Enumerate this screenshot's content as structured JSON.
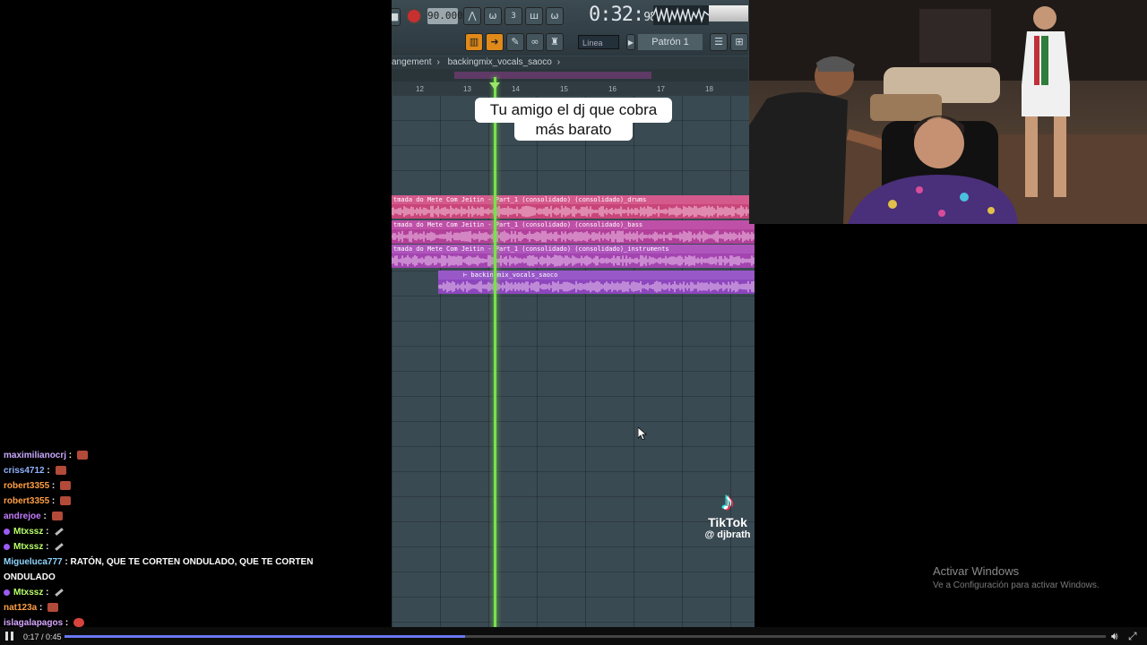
{
  "toolbar": {
    "tempo": "90.000",
    "timer_main": "0:32",
    "timer_frac": "98",
    "timer_unit": "M:S:CS",
    "snap_mode": "Línea",
    "pattern": "Patrón 1"
  },
  "breadcrumb": [
    "angement",
    "backingmix_vocals_saoco"
  ],
  "ruler": [
    "12",
    "13",
    "14",
    "15",
    "16",
    "17",
    "18"
  ],
  "tracks": [
    "tmada do Mete Com Jeitin - Part_1 (consolidado) (consolidado)_drums",
    "tmada do Mete Com Jeitin - Part_1 (consolidado) (consolidado)_bass",
    "tmada do Mete Com Jeitin - Part_1 (consolidado) (consolidado)_instruments",
    "⊢ backingmix_vocals_saoco"
  ],
  "caption": {
    "line1": "Tu amigo el dj que cobra",
    "line2": "más barato"
  },
  "tiktok": {
    "brand": "TikTok",
    "user": "@ djbrath"
  },
  "chat": [
    {
      "user": "maximilianocrj",
      "color": "#c9a9ff",
      "text": "",
      "emote": "red",
      "badge": false
    },
    {
      "user": "criss4712",
      "color": "#8fb4ff",
      "text": "",
      "emote": "red",
      "badge": false
    },
    {
      "user": "robert3355",
      "color": "#ff9f43",
      "text": "",
      "emote": "red",
      "badge": false
    },
    {
      "user": "robert3355",
      "color": "#ff9f43",
      "text": "",
      "emote": "red",
      "badge": false
    },
    {
      "user": "andrejoe",
      "color": "#c57cff",
      "text": "",
      "emote": "red",
      "badge": false
    },
    {
      "user": "Mtxssz",
      "color": "#b8ff6a",
      "text": "",
      "emote": "knife",
      "badge": true
    },
    {
      "user": "Mtxssz",
      "color": "#b8ff6a",
      "text": "",
      "emote": "knife",
      "badge": true
    },
    {
      "user": "Migueluca777",
      "color": "#8fd4ff",
      "text": "RATÓN, QUE TE CORTEN ONDULADO, QUE TE CORTEN",
      "emote": "",
      "badge": false
    },
    {
      "user": "",
      "color": "#ffffff",
      "text": "ONDULADO",
      "emote": "",
      "badge": false
    },
    {
      "user": "Mtxssz",
      "color": "#b8ff6a",
      "text": "",
      "emote": "knife",
      "badge": true
    },
    {
      "user": "nat123a",
      "color": "#ff9f43",
      "text": "",
      "emote": "red",
      "badge": false
    },
    {
      "user": "islagalapagos",
      "color": "#d7a7ff",
      "text": "",
      "emote": "face",
      "badge": false
    }
  ],
  "watermark": {
    "title": "Activar Windows",
    "subtitle": "Ve a Configuración para activar Windows."
  },
  "player": {
    "time": "0:17 / 0:45",
    "progress_fraction": 0.385
  }
}
